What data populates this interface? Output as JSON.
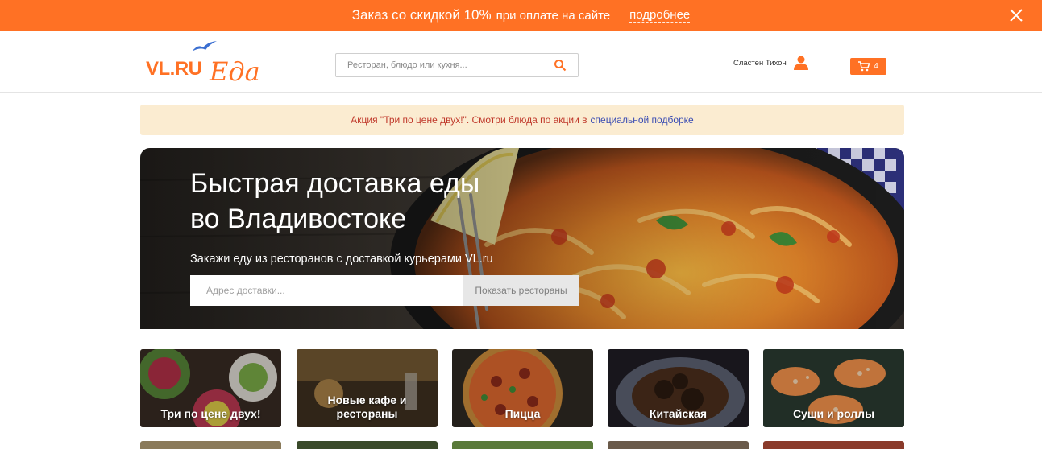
{
  "promo": {
    "main": "Заказ со скидкой 10%",
    "sub": "при оплате на сайте",
    "link": "подробнее"
  },
  "header": {
    "logo_vl": "VL.RU",
    "logo_eda": "Еда",
    "search_placeholder": "Ресторан, блюдо или кухня...",
    "user_name": "Сластен Тихон",
    "cart_count": "4"
  },
  "notice": {
    "text": "Акция \"Три по цене двух!\". Смотри блюда по акции в",
    "link": "специальной подборке"
  },
  "hero": {
    "title_line1": "Быстрая доставка еды",
    "title_line2": "во Владивостоке",
    "subtitle": "Закажи еду из ресторанов с доставкой курьерами VL.ru",
    "address_placeholder": "Адрес доставки...",
    "button": "Показать рестораны"
  },
  "categories": [
    {
      "label": "Три по цене двух!"
    },
    {
      "label": "Новые кафе и рестораны"
    },
    {
      "label": "Пицца"
    },
    {
      "label": "Китайская"
    },
    {
      "label": "Суши и роллы"
    }
  ],
  "colors": {
    "accent": "#ff7124",
    "notice_bg": "#fbecd1",
    "notice_text": "#c0392b",
    "link": "#3b4db3"
  },
  "icons": [
    "close-icon",
    "bird-icon",
    "search-icon",
    "user-icon",
    "cart-icon"
  ]
}
